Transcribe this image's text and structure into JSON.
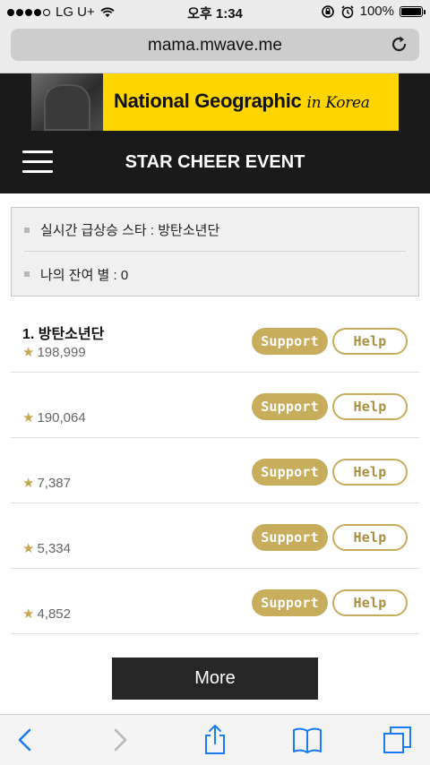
{
  "status_bar": {
    "carrier": "LG U+",
    "time": "오후 1:34",
    "battery": "100%"
  },
  "browser": {
    "url": "mama.mwave.me"
  },
  "ad": {
    "text": "National Geographic",
    "script": "in Korea"
  },
  "header": {
    "title": "STAR CHEER EVENT"
  },
  "info": {
    "rising_star": "실시간 급상승 스타 : 방탄소년단",
    "remaining_stars": "나의 잔여 별 : 0"
  },
  "list": {
    "support_label": "Support",
    "help_label": "Help",
    "star_glyph": "★",
    "items": [
      {
        "rank": "1. 방탄소년단",
        "score": "198,999"
      },
      {
        "rank": "",
        "score": "190,064"
      },
      {
        "rank": "",
        "score": "7,387"
      },
      {
        "rank": "",
        "score": "5,334"
      },
      {
        "rank": "",
        "score": "4,852"
      }
    ]
  },
  "more_label": "More",
  "colors": {
    "accent_gold": "#c8ad5c",
    "ios_blue": "#1a7cf5",
    "header_bg": "#1a1a1a"
  },
  "icons": {
    "toolbar": [
      "back-icon",
      "forward-icon",
      "share-icon",
      "bookmarks-icon",
      "tabs-icon"
    ],
    "status": [
      "wifi-icon",
      "rotation-lock-icon",
      "alarm-icon",
      "battery-icon"
    ],
    "header": [
      "hamburger-menu-icon"
    ],
    "url": [
      "reload-icon"
    ]
  }
}
